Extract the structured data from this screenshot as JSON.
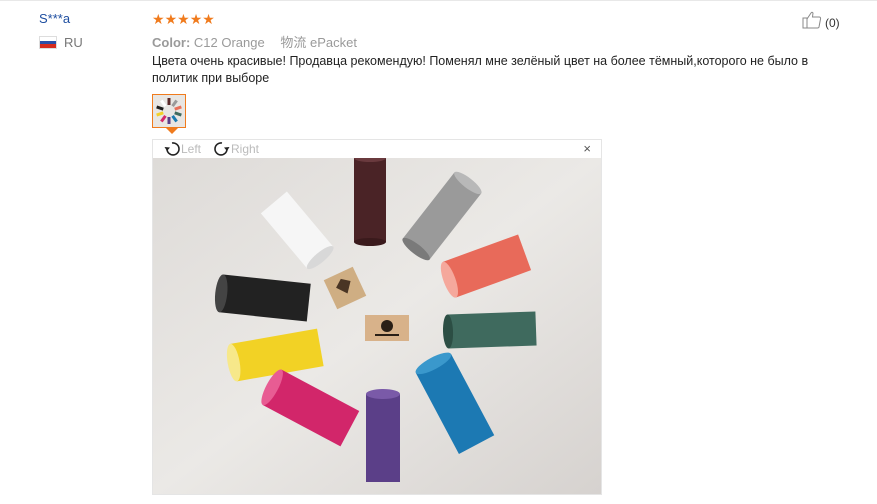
{
  "reviewer": {
    "name": "S***a",
    "country_code": "RU"
  },
  "rating": {
    "stars": 5
  },
  "meta": {
    "color_label": "Color:",
    "color_value": "C12 Orange",
    "shipping_label": "物流",
    "shipping_value": "ePacket"
  },
  "review_text": "Цвета очень красивые! Продавца рекомендую! Поменял мне зелёный цвет на более тёмный,которого не было в политик при выборе",
  "like": {
    "count": "(0)"
  },
  "viewer": {
    "rotate_left": "Left",
    "rotate_right": "Right",
    "close": "×"
  },
  "colors": {
    "star": "#f07b1d",
    "name": "#1e4ea0",
    "thumb_border": "#f07b1d"
  }
}
